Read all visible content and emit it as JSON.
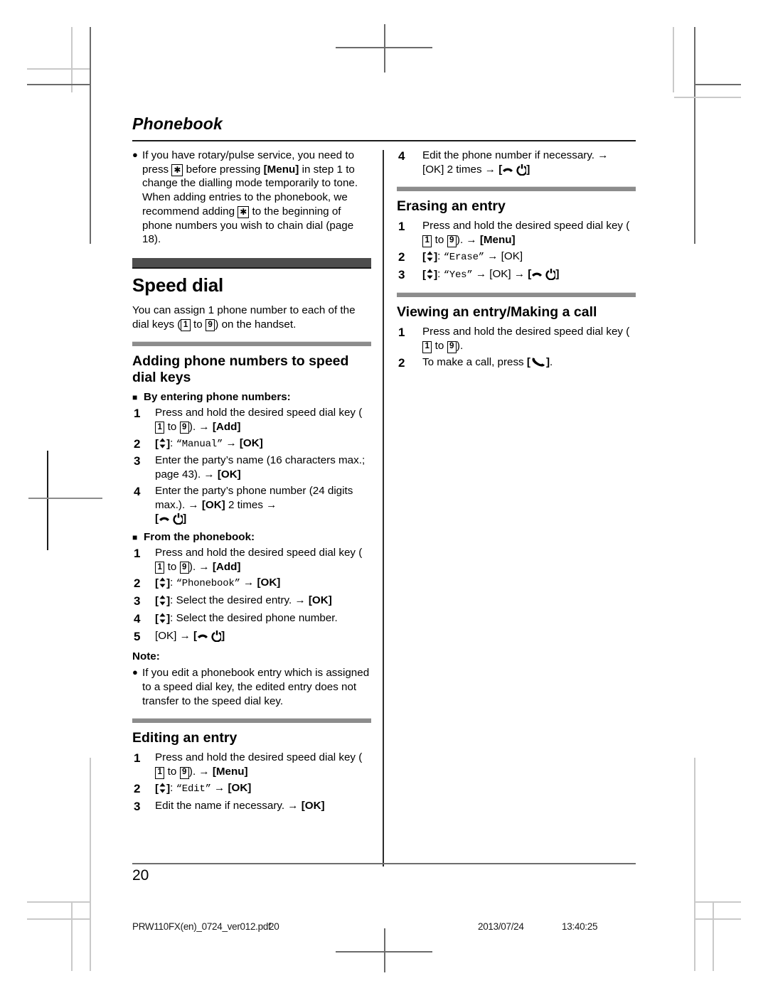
{
  "chapter": {
    "title": "Phonebook"
  },
  "glyphs": {
    "nav_icon": "navigator-key-icon",
    "power_icon": "power-offhook-key-icon",
    "talk_icon": "talk-key-icon",
    "star_icon": "asterisk-key-icon",
    "arrow": "→",
    "key_1": "1",
    "key_9": "9"
  },
  "left": {
    "intro_bullet": {
      "p1": "If you have rotary/pulse service, you need to press ",
      "p2": " before pressing ",
      "menu": "[Menu]",
      "p3": " in step 1 to change the dialling mode temporarily to tone. When adding entries to the phonebook, we recommend adding ",
      "p4": " to the beginning of phone numbers you wish to chain dial (page 18)."
    },
    "speed_dial": {
      "heading": "Speed dial",
      "lead_a": "You can assign 1 phone number to each of the dial keys (",
      "lead_to": " to ",
      "lead_b": ") on the handset."
    },
    "adding": {
      "heading": "Adding phone numbers to speed dial keys",
      "group1_label": "By entering phone numbers:",
      "group1_steps": [
        {
          "num": "1",
          "a": "Press and hold the desired speed dial key (",
          "to": " to ",
          "b": "). ",
          "key": "[Add]"
        },
        {
          "num": "2",
          "value": "“Manual”",
          "key": "[OK]"
        },
        {
          "num": "3",
          "a": "Enter the party’s name (16 characters max.; page 43). ",
          "key": "[OK]"
        },
        {
          "num": "4",
          "a": "Enter the party’s phone number (24 digits max.). ",
          "key": "[OK]",
          "times": " 2 times "
        }
      ],
      "group2_label": "From the phonebook:",
      "group2_steps": [
        {
          "num": "1",
          "a": "Press and hold the desired speed dial key (",
          "to": " to ",
          "b": "). ",
          "key": "[Add]"
        },
        {
          "num": "2",
          "value": "“Phonebook”",
          "key": "[OK]"
        },
        {
          "num": "3",
          "a": "Select the desired entry. ",
          "key": "[OK]"
        },
        {
          "num": "4",
          "a": "Select the desired phone number."
        },
        {
          "num": "5",
          "key": "[OK]"
        }
      ]
    },
    "note": {
      "label": "Note:",
      "text": "If you edit a phonebook entry which is assigned to a speed dial key, the edited entry does not transfer to the speed dial key."
    },
    "editing": {
      "heading": "Editing an entry",
      "steps": [
        {
          "num": "1",
          "a": "Press and hold the desired speed dial key (",
          "to": " to ",
          "b": "). ",
          "key": "[Menu]"
        },
        {
          "num": "2",
          "value": "“Edit”",
          "key": "[OK]"
        },
        {
          "num": "3",
          "a": "Edit the name if necessary. ",
          "key": "[OK]"
        }
      ]
    }
  },
  "right": {
    "editing_cont": {
      "num": "4",
      "a": "Edit the phone number if necessary. ",
      "key": "[OK]",
      "times": " 2 times "
    },
    "erasing": {
      "heading": "Erasing an entry",
      "steps": [
        {
          "num": "1",
          "a": "Press and hold the desired speed dial key (",
          "to": " to ",
          "b": "). ",
          "key": "[Menu]"
        },
        {
          "num": "2",
          "value": "“Erase”",
          "key": "[OK]"
        },
        {
          "num": "3",
          "value": "“Yes”",
          "key": "[OK]"
        }
      ]
    },
    "viewing": {
      "heading": "Viewing an entry/Making a call",
      "steps": [
        {
          "num": "1",
          "a": "Press and hold the desired speed dial key (",
          "to": " to ",
          "b": ")."
        },
        {
          "num": "2",
          "a": "To make a call, press ",
          "b": "."
        }
      ]
    }
  },
  "footer": {
    "page_number": "20",
    "file": "PRW110FX(en)_0724_ver012.pdf",
    "file_page": "20",
    "date": "2013/07/24",
    "time": "13:40:25"
  }
}
